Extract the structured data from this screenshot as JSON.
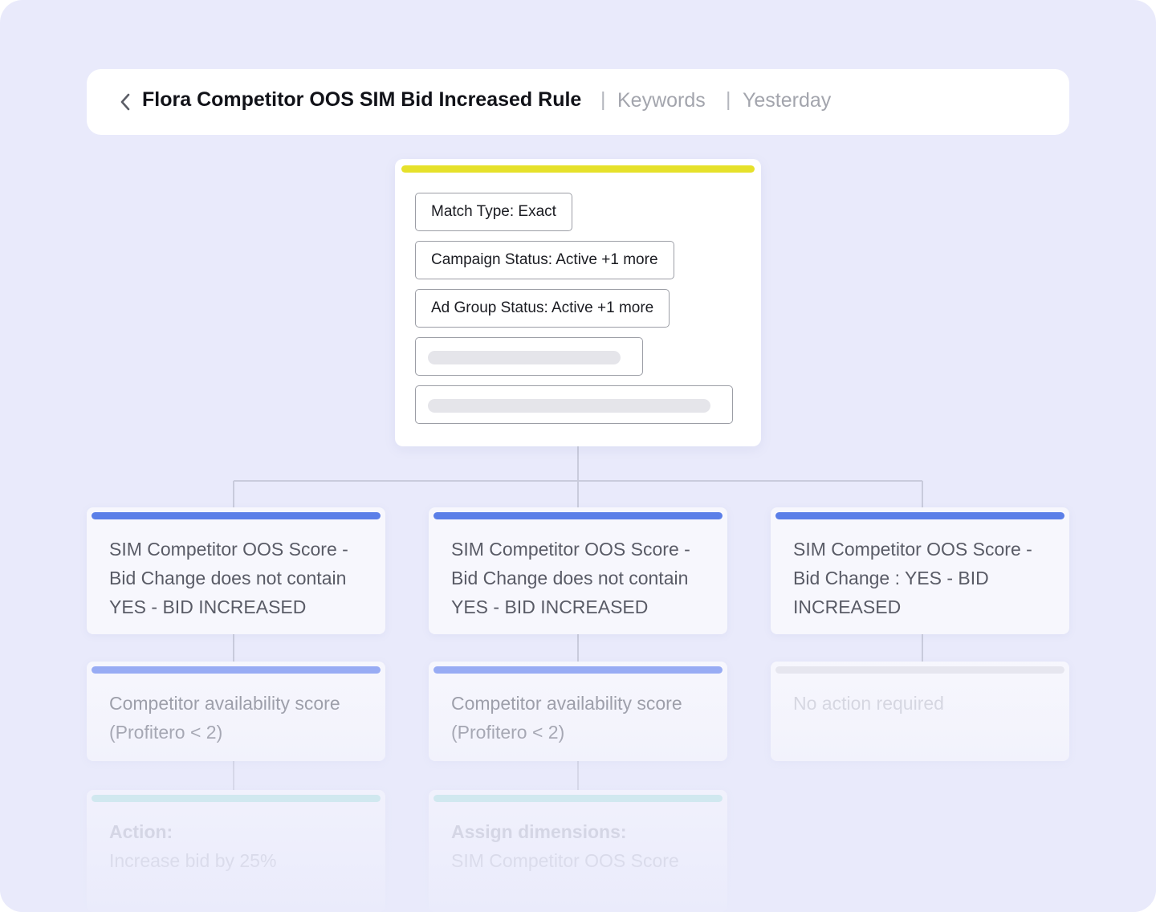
{
  "header": {
    "title": "Flora Competitor OOS SIM Bid Increased Rule",
    "separator": "|",
    "crumb_1": "Keywords",
    "crumb_2": "Yesterday",
    "back_icon": "chevron-left-icon"
  },
  "filters": {
    "accent_color": "#e6e12a",
    "chips": [
      "Match Type: Exact",
      "Campaign Status: Active +1 more",
      "Ad Group Status: Active +1 more"
    ]
  },
  "branches": [
    {
      "condition": "SIM Competitor OOS Score - Bid Change does not contain YES - BID INCREASED",
      "check": "Competitor availability score (Profitero < 2)",
      "result_heading": "Action:",
      "result_value": "Increase bid by 25%"
    },
    {
      "condition": "SIM Competitor OOS Score - Bid Change does not contain YES - BID INCREASED",
      "check": "Competitor availability score (Profitero < 2)",
      "result_heading": "Assign dimensions:",
      "result_value": "SIM Competitor OOS Score"
    },
    {
      "condition": "SIM Competitor OOS Score - Bid Change : YES - BID INCREASED",
      "check": "No action required"
    }
  ],
  "colors": {
    "condition_bar": "#5b7fe8",
    "check_bar": "#93a8f3",
    "result_bar": "#b9e6e4",
    "disabled_bar": "#e6e6ee",
    "background": "#e9eafb"
  }
}
